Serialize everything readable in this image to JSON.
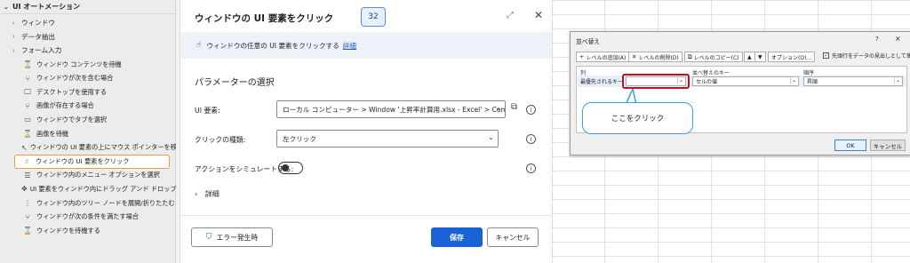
{
  "sidebar": {
    "header": "UI オートメーション",
    "items": [
      {
        "label": "ウィンドウ",
        "type": "cat",
        "icon": "chevron-right-icon",
        "glyph": "›"
      },
      {
        "label": "データ抽出",
        "type": "cat",
        "icon": "chevron-right-icon",
        "glyph": "›"
      },
      {
        "label": "フォーム入力",
        "type": "cat",
        "icon": "chevron-right-icon",
        "glyph": "›"
      },
      {
        "label": "ウィンドウ コンテンツを待機",
        "type": "act",
        "icon": "hourglass-icon",
        "glyph": "⌛"
      },
      {
        "label": "ウィンドウが次を含む場合",
        "type": "act",
        "icon": "branch-icon",
        "glyph": "⑂"
      },
      {
        "label": "デスクトップを使用する",
        "type": "act",
        "icon": "monitor-icon",
        "glyph": "🖵"
      },
      {
        "label": "画像が存在する場合",
        "type": "act",
        "icon": "branch-icon",
        "glyph": "⑂"
      },
      {
        "label": "ウィンドウでタブを選択",
        "type": "act",
        "icon": "tab-icon",
        "glyph": "▭"
      },
      {
        "label": "画像を待機",
        "type": "act",
        "icon": "hourglass-icon",
        "glyph": "⌛"
      },
      {
        "label": "ウィンドウの UI 要素の上にマウス ポインターを移動する",
        "type": "act",
        "icon": "pointer-icon",
        "glyph": "↖"
      },
      {
        "label": "ウィンドウの UI 要素をクリック",
        "type": "act",
        "icon": "click-icon",
        "glyph": "☝",
        "selected": true
      },
      {
        "label": "ウィンドウ内のメニュー オプションを選択",
        "type": "act",
        "icon": "menu-icon",
        "glyph": "☰"
      },
      {
        "label": "UI 要素をウィンドウ内にドラッグ アンド ドロップ",
        "type": "act",
        "icon": "drag-icon",
        "glyph": "✥"
      },
      {
        "label": "ウィンドウ内のツリー ノードを展開/折りたたむ",
        "type": "act",
        "icon": "tree-icon",
        "glyph": "⋮"
      },
      {
        "label": "ウィンドウが次の条件を満たす場合",
        "type": "act",
        "icon": "branch-icon",
        "glyph": "⑂"
      },
      {
        "label": "ウィンドウを待機する",
        "type": "act",
        "icon": "hourglass-icon",
        "glyph": "⌛"
      }
    ]
  },
  "dialog": {
    "title": "ウィンドウの UI 要素をクリック",
    "badge": "32",
    "info_text": "ウィンドウの任意の UI 要素をクリックする",
    "info_link": "詳細",
    "section": "パラメーターの選択",
    "ui_element_label": "UI 要素:",
    "ui_element_value": "ローカル コンピューター > Window '上昇率計算用.xlsx - Excel' > Com",
    "click_type_label": "クリックの種類:",
    "click_type_value": "左クリック",
    "simulate_label": "アクションをシミュレートする:",
    "details": "詳細",
    "error_button": "エラー発生時",
    "save_button": "保存",
    "cancel_button": "キャンセル"
  },
  "sort_dialog": {
    "title": "並べ替え",
    "help": "?",
    "close": "×",
    "add_level": "レベルの追加(A)",
    "delete_level": "レベルの削除(D)",
    "copy_level": "レベルのコピー(C)",
    "options": "オプション(O)...",
    "header_checkbox": "先頭行をデータの見出しとして使用する(H)",
    "col_header": "列",
    "sortkey_header": "並べ替えのキー",
    "order_header": "順序",
    "row_label": "最優先されるキー",
    "sortkey_value": "セルの値",
    "order_value": "昇順",
    "ok": "OK",
    "cancel": "キャンセル"
  },
  "callout": {
    "text": "ここをクリック"
  }
}
